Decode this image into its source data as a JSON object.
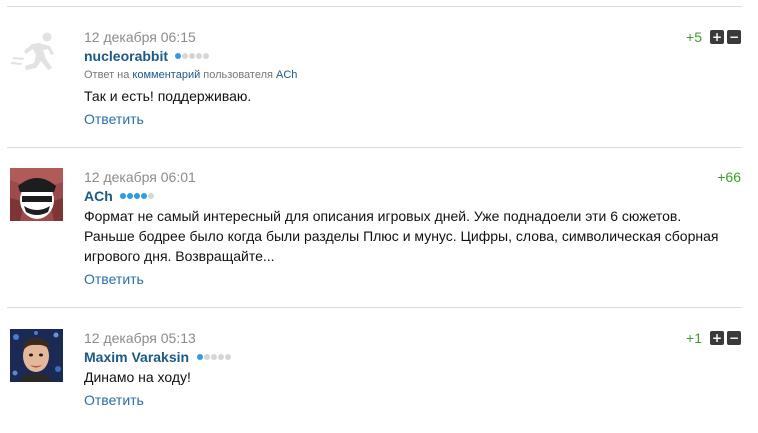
{
  "comments": [
    {
      "date": "12 декабря 06:15",
      "author": "nucleorabbit",
      "reputation_level": 1,
      "reply_prefix": "Ответ на",
      "reply_link": "комментарий",
      "reply_middle": "пользователя",
      "reply_user": "ACh",
      "lines": [
        "Так и есть! поддерживаю."
      ],
      "reply_label": "Ответить",
      "score": "+5",
      "vote_plus": "+",
      "vote_minus": "−",
      "avatar_icon": "runner-icon"
    },
    {
      "date": "12 декабря 06:01",
      "author": "ACh",
      "reputation_level": 4,
      "lines": [
        "Формат не самый интересный для описания игровых дней. Уже поднадоели эти 6 сюжетов.",
        "Раньше бодрее было когда были разделы Плюс и мунус. Цифры, слова, символическая сборная",
        "игрового дня. Возвращайте..."
      ],
      "reply_label": "Ответить",
      "score": "+66",
      "avatar_icon": "masked-face-icon"
    },
    {
      "date": "12 декабря 05:13",
      "author": "Maxim Varaksin",
      "reputation_level": 1,
      "lines": [
        "Динамо на ходу!"
      ],
      "reply_label": "Ответить",
      "score": "+1",
      "vote_plus": "+",
      "vote_minus": "−",
      "avatar_icon": "person-photo-icon"
    }
  ],
  "colors": {
    "author": "#1b5a86",
    "link": "#2a6fa8",
    "score_positive": "#3e9e2c",
    "rep_dot_on": "#2f9be3",
    "rep_dot_off": "#d6d6d6"
  }
}
